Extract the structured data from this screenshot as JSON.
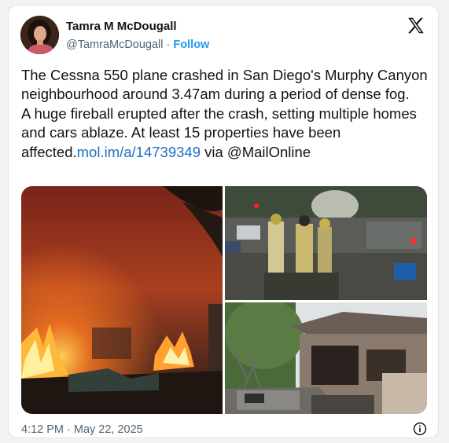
{
  "author": {
    "display_name": "Tamra M McDougall",
    "handle": "@TamraMcDougall",
    "separator": "·",
    "follow_label": "Follow"
  },
  "tweet": {
    "paragraph1": "The Cessna 550 plane crashed in San Diego's Murphy Canyon neighbourhood around 3.47am during a period of dense fog.",
    "paragraph2_text": "A huge fireball erupted after the crash, setting multiple homes and cars ablaze. At least 15 properties have been affected.",
    "link": "mol.im/a/14739349",
    "suffix": " via @MailOnline",
    "timestamp": "4:12 PM · May 22, 2025"
  },
  "icons": {
    "platform": "x-logo-icon",
    "info": "info-icon"
  },
  "colors": {
    "accent": "#1d9bf0",
    "text": "#0f1419",
    "muted": "#536471"
  }
}
